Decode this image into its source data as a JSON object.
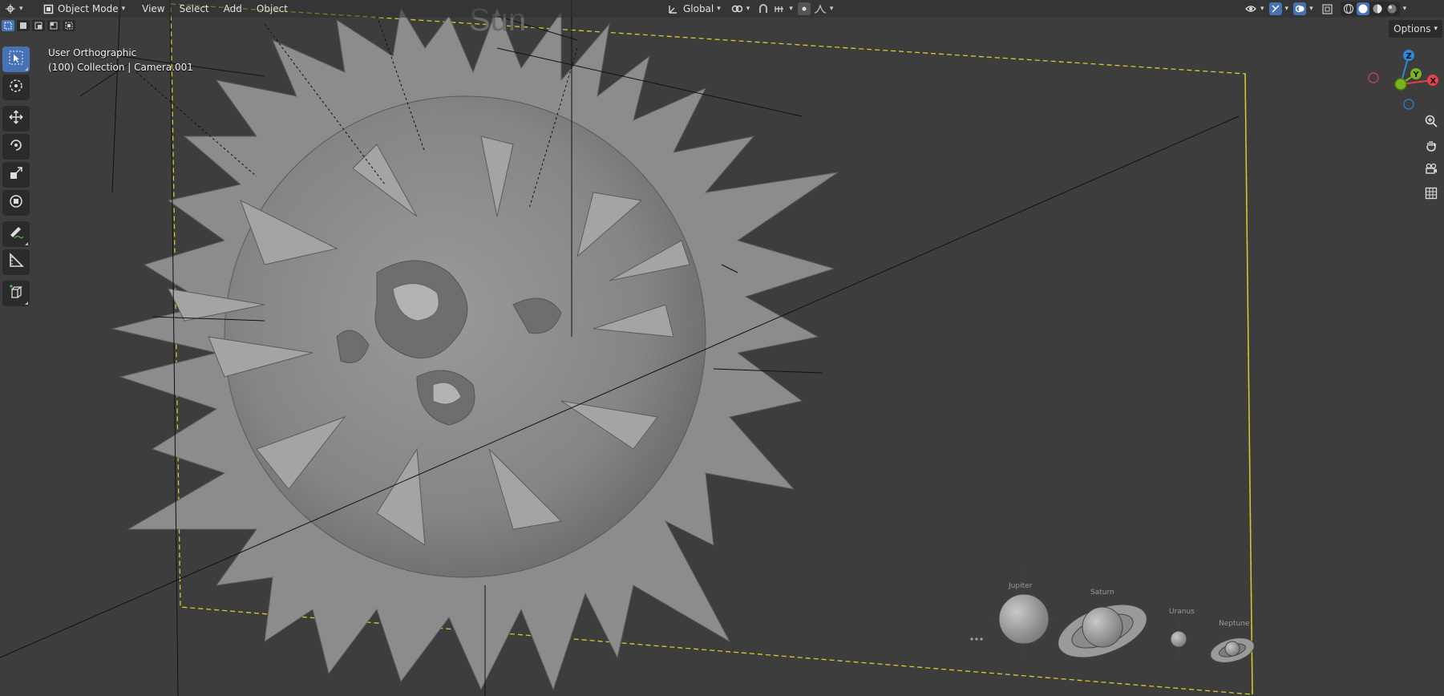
{
  "header": {
    "mode_label": "Object Mode",
    "menus": [
      "View",
      "Select",
      "Add",
      "Object"
    ],
    "orientation_label": "Global"
  },
  "viewport": {
    "view_name": "User Orthographic",
    "collection_info": "(100) Collection | Camera.001",
    "options_label": "Options"
  },
  "gizmo": {
    "z_label": "Z",
    "y_label": "Y",
    "x_label": "X",
    "colors": {
      "x": "#e5424a",
      "y": "#7ab51d",
      "z": "#2f87d9"
    }
  },
  "scene": {
    "top_text": "Sun",
    "planet_labels": [
      "Jupiter",
      "Saturn",
      "Uranus",
      "Neptune"
    ]
  },
  "toolbar": {
    "tools": [
      "select-box",
      "cursor",
      "move",
      "rotate",
      "scale",
      "transform",
      "annotate",
      "measure",
      "add-cube"
    ]
  },
  "icons": [
    "editor-type-icon",
    "object-mode-icon",
    "orientation-icon",
    "pivot-icon",
    "snap-icon",
    "proportional-icon",
    "visibility-icon",
    "gizmo-icon",
    "overlay-icon",
    "xray-icon",
    "wireframe-icon",
    "solid-icon",
    "material-icon",
    "rendered-icon",
    "zoom-icon",
    "pan-icon",
    "camera-view-icon",
    "ortho-grid-icon"
  ]
}
